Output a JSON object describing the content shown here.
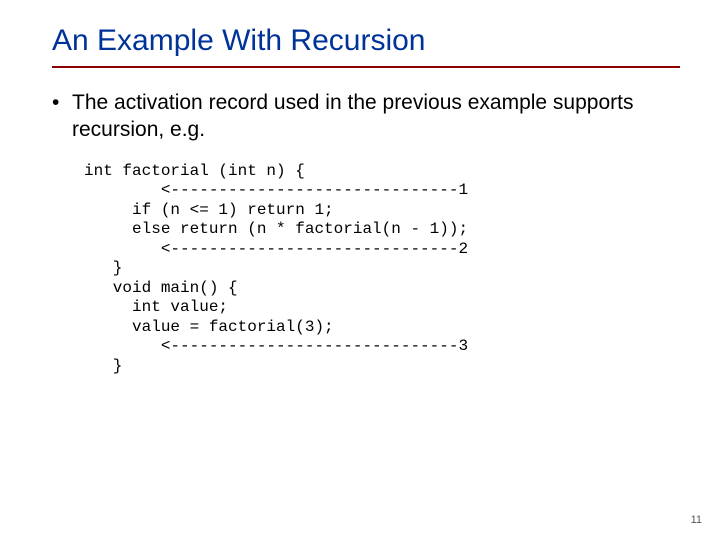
{
  "title": "An Example With Recursion",
  "bullet": {
    "marker": "•",
    "text": "The activation record used in the previous example supports recursion, e.g."
  },
  "code": "int factorial (int n) {\n        <------------------------------1\n     if (n <= 1) return 1;\n     else return (n * factorial(n - 1));\n        <------------------------------2\n   }\n   void main() {\n     int value;\n     value = factorial(3);\n        <------------------------------3\n   }",
  "page_number": "11"
}
